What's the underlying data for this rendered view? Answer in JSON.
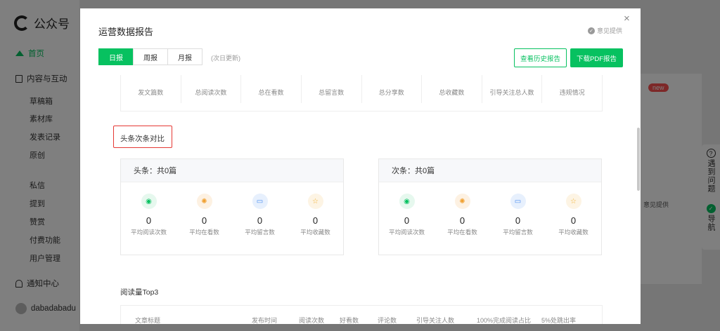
{
  "app": {
    "brand": "公众号",
    "nav_home": "首页",
    "nav_content": "内容与互动",
    "nav_sub": [
      "草稿箱",
      "素材库",
      "发表记录",
      "原创",
      "私信",
      "提到",
      "赞赏",
      "付费功能",
      "用户管理"
    ],
    "nav_notify": "通知中心",
    "user": "dabadabadu",
    "badge_new": "new",
    "help_q": "?",
    "help_label": "遇到问题",
    "guide_label": "导航",
    "bg_feedback": "意见提供"
  },
  "modal": {
    "title": "运营数据报告",
    "close": "×",
    "feedback": "意见提供",
    "tabs": [
      "日报",
      "周报",
      "月报"
    ],
    "tab_note": "(次日更新)",
    "btn_history": "查看历史报告",
    "btn_download": "下载PDF报告",
    "summary_headers": [
      "发文篇数",
      "总阅读次数",
      "总在看数",
      "总留言数",
      "总分享数",
      "总收藏数",
      "引导关注总人数",
      "违规情况"
    ],
    "section_compare": "头条次条对比",
    "headline": {
      "title": "头条：共0篇",
      "stats": [
        {
          "value": "0",
          "label": "平均阅读次数",
          "icon": "eye-icon"
        },
        {
          "value": "0",
          "label": "平均在看数",
          "icon": "sparkle-icon"
        },
        {
          "value": "0",
          "label": "平均留言数",
          "icon": "comment-icon"
        },
        {
          "value": "0",
          "label": "平均收藏数",
          "icon": "star-icon"
        }
      ]
    },
    "secondary": {
      "title": "次条：共0篇",
      "stats": [
        {
          "value": "0",
          "label": "平均阅读次数",
          "icon": "eye-icon"
        },
        {
          "value": "0",
          "label": "平均在看数",
          "icon": "sparkle-icon"
        },
        {
          "value": "0",
          "label": "平均留言数",
          "icon": "comment-icon"
        },
        {
          "value": "0",
          "label": "平均收藏数",
          "icon": "star-icon"
        }
      ]
    },
    "section_top3": "阅读量Top3",
    "top3_headers": [
      "文章标题",
      "发布时间",
      "阅读次数",
      "好看数",
      "评论数",
      "引导关注人数",
      "100%完成阅读占比",
      "5%处跳出率"
    ]
  },
  "colors": {
    "accent": "#07c160",
    "highlight_border": "#e53935"
  }
}
